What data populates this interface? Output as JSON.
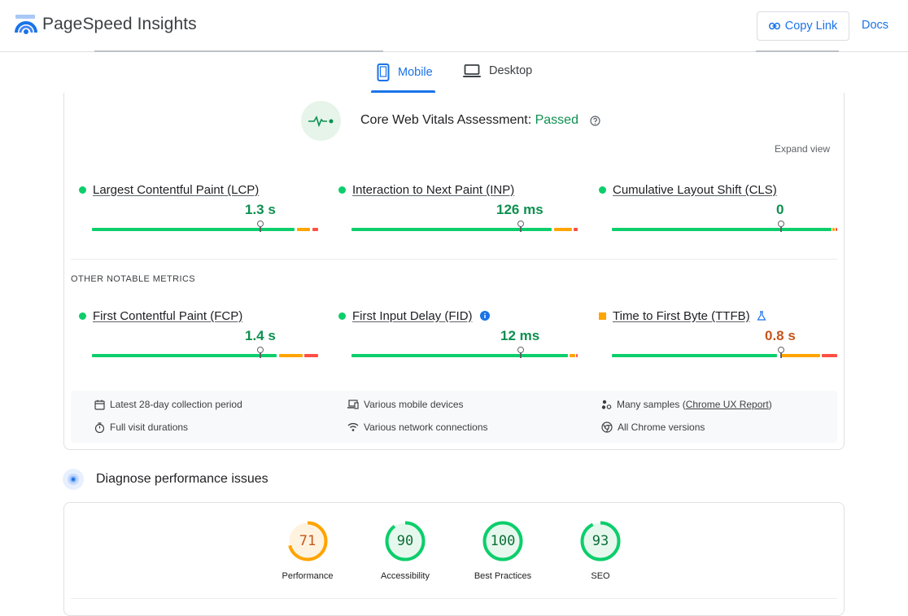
{
  "header": {
    "app_title": "PageSpeed Insights",
    "copy_link_label": "Copy Link",
    "docs_label": "Docs"
  },
  "tabs": [
    {
      "label": "Mobile",
      "selected": true
    },
    {
      "label": "Desktop",
      "selected": false
    }
  ],
  "cwv": {
    "title": "Core Web Vitals Assessment: ",
    "status": "Passed",
    "expand_label": "Expand view",
    "metrics": [
      {
        "name": "Largest Contentful Paint (LCP)",
        "value": "1.3 s",
        "status": "good"
      },
      {
        "name": "Interaction to Next Paint (INP)",
        "value": "126 ms",
        "status": "good"
      },
      {
        "name": "Cumulative Layout Shift (CLS)",
        "value": "0",
        "status": "good"
      }
    ]
  },
  "other_metrics": {
    "section_label": "OTHER NOTABLE METRICS",
    "metrics": [
      {
        "name": "First Contentful Paint (FCP)",
        "value": "1.4 s",
        "status": "good"
      },
      {
        "name": "First Input Delay (FID)",
        "value": "12 ms",
        "status": "good"
      },
      {
        "name": "Time to First Byte (TTFB)",
        "value": "0.8 s",
        "status": "needs-improvement"
      }
    ]
  },
  "info": {
    "collection_period": "Latest 28-day collection period",
    "devices": "Various mobile devices",
    "samples_prefix": "Many samples (",
    "samples_link": "Chrome UX Report",
    "samples_suffix": ")",
    "visit_durations": "Full visit durations",
    "network": "Various network connections",
    "chrome_versions": "All Chrome versions"
  },
  "diagnose": {
    "title": "Diagnose performance issues"
  },
  "scores": [
    {
      "label": "Performance",
      "value": 71,
      "color": "#ffa400",
      "text_color": "#c5561b",
      "bg": "#fff3e0"
    },
    {
      "label": "Accessibility",
      "value": 90,
      "color": "#0cce6b",
      "text_color": "#0d6e36",
      "bg": "#e6f8ee"
    },
    {
      "label": "Best Practices",
      "value": 100,
      "color": "#0cce6b",
      "text_color": "#0d6e36",
      "bg": "#e6f8ee"
    },
    {
      "label": "SEO",
      "value": 93,
      "color": "#0cce6b",
      "text_color": "#0d6e36",
      "bg": "#e6f8ee"
    }
  ],
  "colors": {
    "accent": "#1a73e8",
    "good": "#0cce6b",
    "average": "#ffa400",
    "poor": "#ff4e42"
  }
}
